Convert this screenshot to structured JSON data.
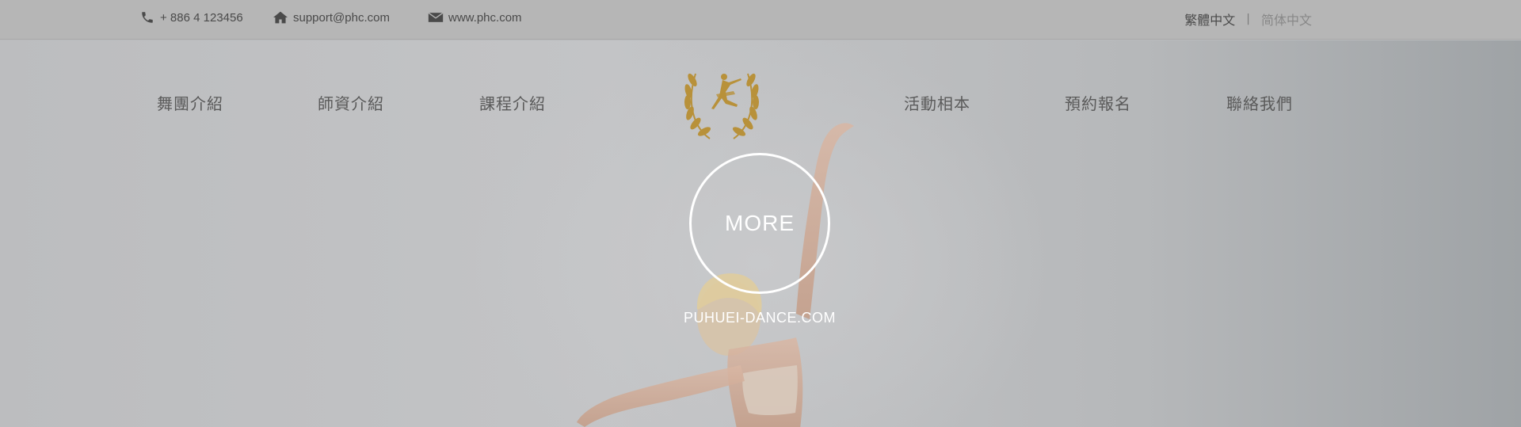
{
  "topbar": {
    "phone": "+ 886 4 123456",
    "email": "support@phc.com",
    "website": "www.phc.com",
    "lang_traditional": "繁體中文",
    "lang_separator": "|",
    "lang_simplified": "简体中文"
  },
  "nav": {
    "items": [
      {
        "label": "舞團介紹"
      },
      {
        "label": "師資介紹"
      },
      {
        "label": "課程介紹"
      },
      {
        "label": "活動相本"
      },
      {
        "label": "預約報名"
      },
      {
        "label": "聯絡我們"
      }
    ]
  },
  "hero": {
    "more_label": "MORE",
    "site_name": "PUHUEI-DANCE.COM"
  },
  "colors": {
    "gold": "#b8913a",
    "white": "#ffffff"
  },
  "icons": {
    "phone": "phone-icon",
    "home": "home-icon",
    "mail": "mail-icon",
    "logo": "laurel-ballerina-logo"
  }
}
